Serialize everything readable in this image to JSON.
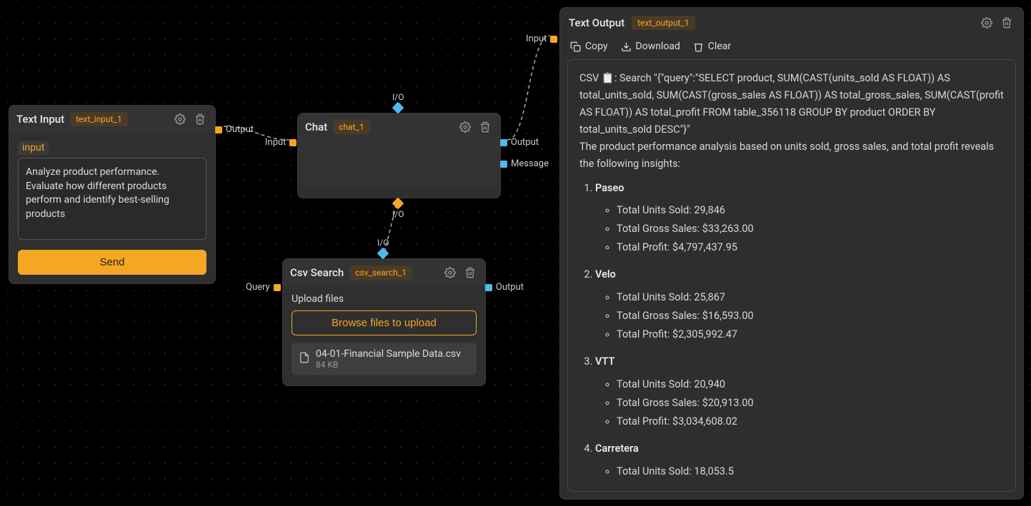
{
  "text_input": {
    "title": "Text Input",
    "tag": "text_input_1",
    "label": "input",
    "value": "Analyze product performance. Evaluate how different products perform and identify best-selling products",
    "send_label": "Send",
    "port_output": "Output"
  },
  "chat": {
    "title": "Chat",
    "tag": "chat_1",
    "port_input": "Input",
    "port_output": "Output",
    "port_message": "Message",
    "port_io_top": "I/O",
    "port_io_bottom": "I/O"
  },
  "csv_search": {
    "title": "Csv Search",
    "tag": "csv_search_1",
    "upload_label": "Upload files",
    "browse_label": "Browse files to upload",
    "file_name": "04-01-Financial Sample Data.csv",
    "file_size": "84 KB",
    "port_query": "Query",
    "port_output": "Output",
    "port_io_top": "I/O"
  },
  "text_output": {
    "title": "Text Output",
    "tag": "text_output_1",
    "port_input": "Input",
    "copy": "Copy",
    "download": "Download",
    "clear": "Clear",
    "preface": "CSV 📋: Search \"{\"query\":\"SELECT product, SUM(CAST(units_sold AS FLOAT)) AS total_units_sold, SUM(CAST(gross_sales AS FLOAT)) AS total_gross_sales, SUM(CAST(profit AS FLOAT)) AS total_profit FROM table_356118 GROUP BY product ORDER BY total_units_sold DESC\"}\"",
    "intro": "The product performance analysis based on units sold, gross sales, and total profit reveals the following insights:",
    "products": [
      {
        "name": "Paseo",
        "units": "Total Units Sold: 29,846",
        "gross": "Total Gross Sales: $33,263.00",
        "profit": "Total Profit: $4,797,437.95"
      },
      {
        "name": "Velo",
        "units": "Total Units Sold: 25,867",
        "gross": "Total Gross Sales: $16,593.00",
        "profit": "Total Profit: $2,305,992.47"
      },
      {
        "name": "VTT",
        "units": "Total Units Sold: 20,940",
        "gross": "Total Gross Sales: $20,913.00",
        "profit": "Total Profit: $3,034,608.02"
      },
      {
        "name": "Carretera",
        "units": "Total Units Sold: 18,053.5",
        "gross": "",
        "profit": ""
      }
    ]
  }
}
